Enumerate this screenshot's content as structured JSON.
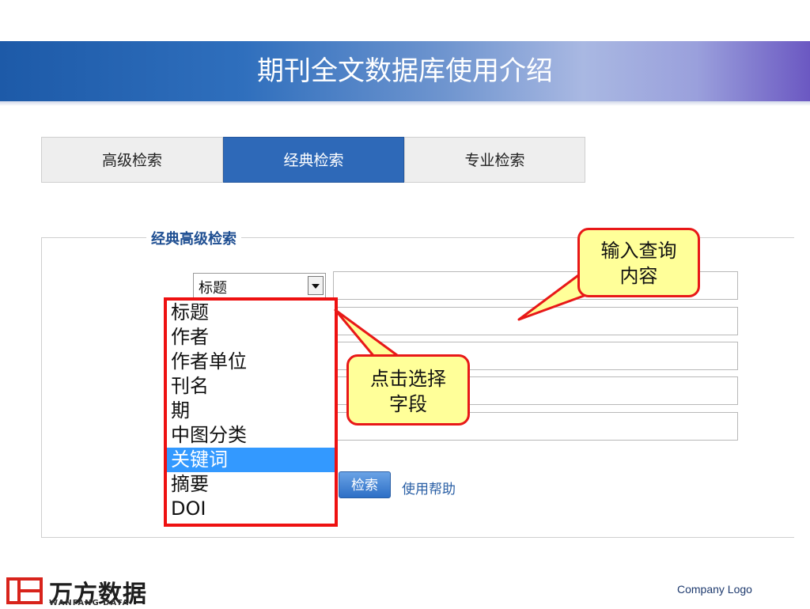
{
  "slide_title": "期刊全文数据库使用介绍",
  "tabs": [
    {
      "label": "高级检索",
      "active": false
    },
    {
      "label": "经典检索",
      "active": true
    },
    {
      "label": "专业检索",
      "active": false
    }
  ],
  "form": {
    "legend": "经典高级检索",
    "field_select": {
      "value": "标题",
      "icon": "chevron-down-icon"
    },
    "dropdown_options": [
      "标题",
      "作者",
      "作者单位",
      "刊名",
      "期",
      "中图分类",
      "关键词",
      "摘要",
      "DOI"
    ],
    "highlighted_option": "关键词",
    "search_button": "检索",
    "help_link": "使用帮助"
  },
  "callouts": {
    "input_query": [
      "输入查询",
      "内容"
    ],
    "select_field": [
      "点击选择",
      "字段"
    ]
  },
  "footer": {
    "brand_cn": "万方数据",
    "brand_en": "WANFANG DATA",
    "company_logo": "Company Logo"
  },
  "colors": {
    "accent": "#2e69b8",
    "callout_fill": "#ffff99",
    "callout_border": "#e81818",
    "dropdown_border": "#ee1111",
    "selection": "#3399ff",
    "brand_red": "#d8231b"
  }
}
